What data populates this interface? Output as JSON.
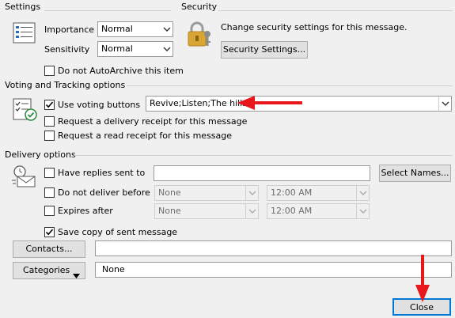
{
  "settings": {
    "title": "Settings",
    "importance_label": "Importance",
    "importance_value": "Normal",
    "sensitivity_label": "Sensitivity",
    "sensitivity_value": "Normal",
    "autoarchive_label": "Do not AutoArchive this item"
  },
  "security": {
    "title": "Security",
    "description": "Change security settings for this message.",
    "button_label": "Security Settings..."
  },
  "voting": {
    "title": "Voting and Tracking options",
    "use_voting_label": "Use voting buttons",
    "voting_value": "Revive;Listen;The hills",
    "delivery_receipt_label": "Request a delivery receipt for this message",
    "read_receipt_label": "Request a read receipt for this message"
  },
  "delivery": {
    "title": "Delivery options",
    "replies_label": "Have replies sent to",
    "replies_value": "",
    "select_names_label": "Select Names...",
    "do_not_deliver_label": "Do not deliver before",
    "do_not_deliver_date": "None",
    "do_not_deliver_time": "12:00 AM",
    "expires_label": "Expires after",
    "expires_date": "None",
    "expires_time": "12:00 AM",
    "save_copy_label": "Save copy of sent message"
  },
  "contacts": {
    "button_label": "Contacts...",
    "value": ""
  },
  "categories": {
    "button_label": "Categories",
    "value": "None"
  },
  "footer": {
    "close_label": "Close"
  },
  "colors": {
    "annotation_arrow": "#e8171b",
    "lock": "#d9a534"
  }
}
